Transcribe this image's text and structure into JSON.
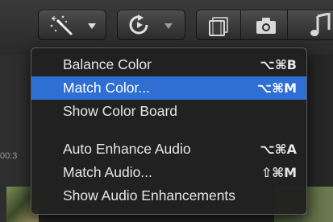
{
  "toolbar": {
    "buttons": [
      {
        "name": "enhancements",
        "icon": "magic-wand-icon"
      },
      {
        "name": "retime",
        "icon": "retime-icon"
      },
      {
        "name": "clip-appearance",
        "icon": "clip-icon"
      },
      {
        "name": "photos",
        "icon": "camera-icon"
      },
      {
        "name": "music",
        "icon": "music-icon"
      }
    ]
  },
  "timeline": {
    "timecode": "00:3"
  },
  "menu": {
    "items": [
      {
        "label": "Balance Color",
        "shortcut": "⌥⌘B"
      },
      {
        "label": "Match Color...",
        "shortcut": "⌥⌘M",
        "highlighted": true
      },
      {
        "label": "Show Color Board",
        "shortcut": ""
      },
      {
        "label": "Auto Enhance Audio",
        "shortcut": "⌥⌘A"
      },
      {
        "label": "Match Audio...",
        "shortcut": "⇧⌘M"
      },
      {
        "label": "Show Audio Enhancements",
        "shortcut": ""
      }
    ]
  },
  "colors": {
    "highlight": "#2f6fd4",
    "menu_bg": "#212121",
    "text": "#e6e6e6"
  }
}
